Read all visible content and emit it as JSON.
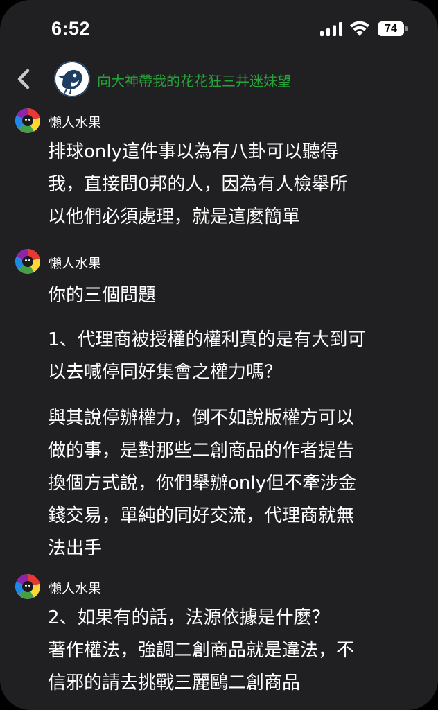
{
  "status_bar": {
    "time": "6:52",
    "battery_level": "74",
    "icons": [
      "cellular-signal-icon",
      "wifi-icon",
      "battery-icon"
    ]
  },
  "header": {
    "back_icon": "chevron-left-icon",
    "group_title": "向大神帶我的花花狂三井迷妹望",
    "group_avatar": "penguin-avatar"
  },
  "colors": {
    "background": "#202022",
    "title_green": "#27a33a",
    "text": "#ffffff"
  },
  "messages": [
    {
      "sender": "懶人水果",
      "paragraphs": [
        [
          "排球only這件事以為有八卦可以聽得",
          "我，直接問0邦的人，因為有人檢舉所",
          "以他們必須處理，就是這麼簡單"
        ]
      ]
    },
    {
      "sender": "懶人水果",
      "paragraphs": [
        [
          "你的三個問題"
        ],
        [
          "1、代理商被授權的權利真的是有大到可",
          "以去喊停同好集會之權力嗎？"
        ],
        [
          "與其說停辦權力，倒不如說版權方可以",
          "做的事，是對那些二創商品的作者提告",
          "換個方式說，你們舉辦only但不牽涉金",
          "錢交易，單純的同好交流，代理商就無",
          "法出手"
        ]
      ]
    },
    {
      "sender": "懶人水果",
      "paragraphs": [
        [
          "2、如果有的話，法源依據是什麼？",
          "著作權法，強調二創商品就是違法，不",
          "信邪的請去挑戰三麗鷗二創商品"
        ]
      ]
    }
  ]
}
